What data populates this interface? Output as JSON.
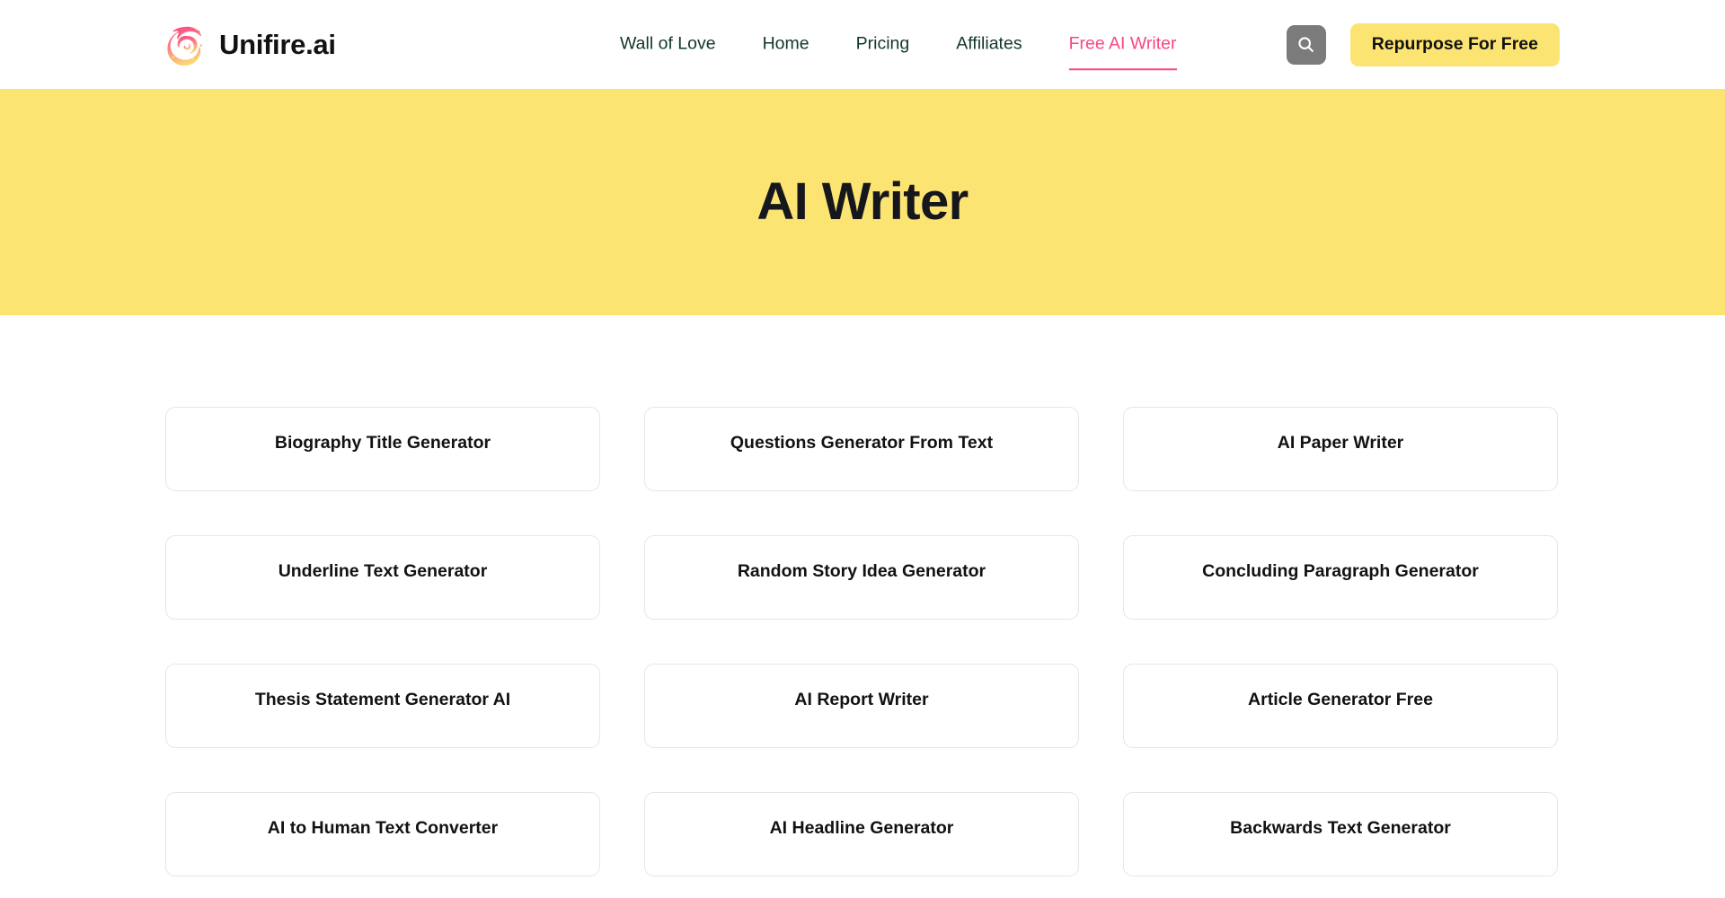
{
  "header": {
    "brand": {
      "name": "Unifire.ai",
      "logo_icon": "flame-swirl-logo",
      "logo_gradient_start": "#f8467f",
      "logo_gradient_end": "#fce473"
    },
    "nav_items": [
      {
        "label": "Wall of Love",
        "active": false,
        "name": "wall-of-love"
      },
      {
        "label": "Home",
        "active": false,
        "name": "home"
      },
      {
        "label": "Pricing",
        "active": false,
        "name": "pricing"
      },
      {
        "label": "Affiliates",
        "active": false,
        "name": "affiliates"
      },
      {
        "label": "Free AI Writer",
        "active": true,
        "name": "free-ai-writer"
      }
    ],
    "search": {
      "icon": "search-icon",
      "background_color": "#7b7b7b"
    },
    "cta": {
      "label": "Repurpose For Free",
      "background_color": "#fce473",
      "text_color": "#121212"
    },
    "nav_text_color": "#12372a",
    "active_color": "#f8467f"
  },
  "hero": {
    "title": "AI Writer",
    "background_color": "#fce473",
    "text_color": "#16161d"
  },
  "tools": {
    "cards": [
      {
        "label": "Biography Title Generator"
      },
      {
        "label": "Questions Generator From Text"
      },
      {
        "label": "AI Paper Writer"
      },
      {
        "label": "Underline Text Generator"
      },
      {
        "label": "Random Story Idea Generator"
      },
      {
        "label": "Concluding Paragraph Generator"
      },
      {
        "label": "Thesis Statement Generator AI"
      },
      {
        "label": "AI Report Writer"
      },
      {
        "label": "Article Generator Free"
      },
      {
        "label": "AI to Human Text Converter"
      },
      {
        "label": "AI Headline Generator"
      },
      {
        "label": "Backwards Text Generator"
      }
    ],
    "card_border_color": "#e6e6e6",
    "card_background": "#ffffff"
  }
}
